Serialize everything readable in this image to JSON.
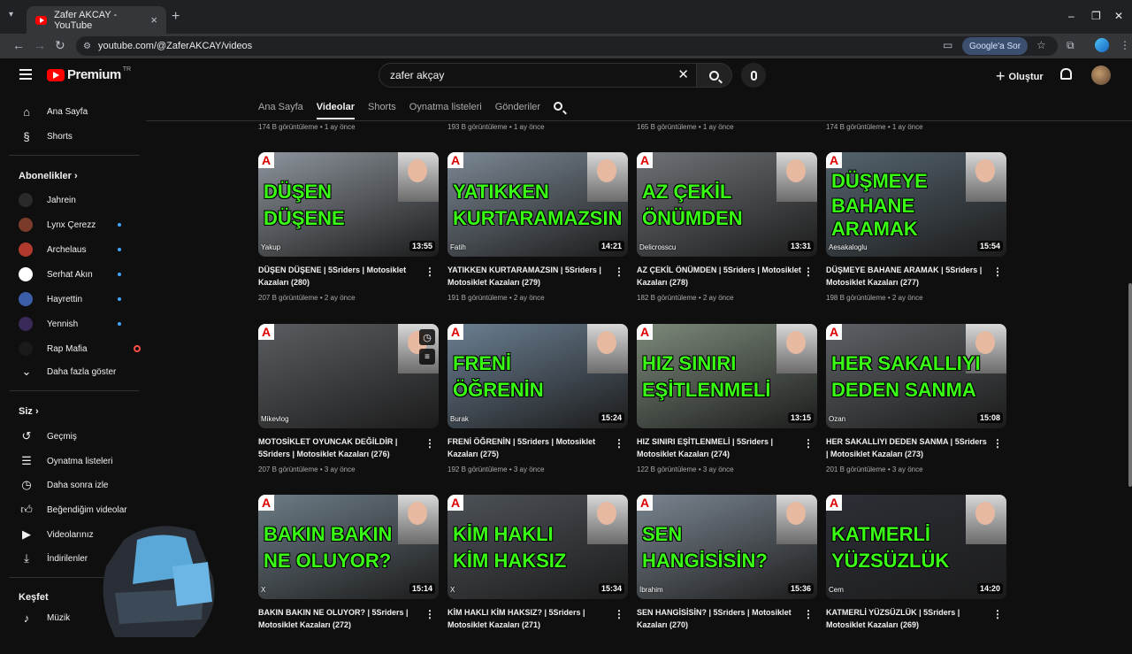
{
  "browser": {
    "tab_title": "Zafer AKCAY - YouTube",
    "url": "youtube.com/@ZaferAKCAY/videos",
    "google_sor": "Google'a Sor"
  },
  "topbar": {
    "logo_text": "Premium",
    "country": "TR",
    "search_value": "zafer akçay",
    "create_label": "Oluştur"
  },
  "sidebar": {
    "home": "Ana Sayfa",
    "shorts": "Shorts",
    "subs_header": "Abonelikler",
    "channels": [
      {
        "name": "Jahrein",
        "color": "#2a2a2a",
        "dot": false
      },
      {
        "name": "Lynx Çerezz",
        "color": "#7a3b2a",
        "dot": true
      },
      {
        "name": "Archelaus",
        "color": "#b03a2e",
        "dot": true
      },
      {
        "name": "Serhat Akın",
        "color": "#ffffff",
        "dot": true
      },
      {
        "name": "Hayrettin",
        "color": "#3b5ea8",
        "dot": true
      },
      {
        "name": "Yennish",
        "color": "#3a2a5a",
        "dot": true
      },
      {
        "name": "Rap Mafia",
        "color": "#1a1a1a",
        "dot": false
      }
    ],
    "show_more": "Daha fazla göster",
    "you_header": "Siz",
    "you_items": [
      "Geçmiş",
      "Oynatma listeleri",
      "Daha sonra izle",
      "Beğendiğim videolar",
      "Videolarınız",
      "İndirilenler"
    ],
    "explore_header": "Keşfet",
    "music": "Müzik"
  },
  "channel_tabs": [
    "Ana Sayfa",
    "Videolar",
    "Shorts",
    "Oynatma listeleri",
    "Gönderiler"
  ],
  "prev_row_meta": [
    "174 B görüntüleme • 1 ay önce",
    "193 B görüntüleme • 1 ay önce",
    "165 B görüntüleme • 1 ay önce",
    "174 B görüntüleme • 1 ay önce"
  ],
  "videos": [
    {
      "title": "DÜŞEN DÜŞENE | 5Sriders | Motosiklet Kazaları (280)",
      "meta": "207 B görüntüleme • 2 ay önce",
      "duration": "13:55",
      "overlay1": "DÜŞEN",
      "overlay2": "DÜŞENE",
      "caption": "Yakup",
      "bg": "#8d949c"
    },
    {
      "title": "YATIKKEN KURTARAMAZSIN | 5Sriders | Motosiklet Kazaları (279)",
      "meta": "191 B görüntüleme • 2 ay önce",
      "duration": "14:21",
      "overlay1": "YATIKKEN",
      "overlay2": "KURTARAMAZSIN",
      "caption": "Fatih",
      "bg": "#7b8894"
    },
    {
      "title": "AZ ÇEKİL ÖNÜMDEN | 5Sriders | Motosiklet Kazaları (278)",
      "meta": "182 B görüntüleme • 2 ay önce",
      "duration": "13:31",
      "overlay1": "AZ ÇEKİL",
      "overlay2": "ÖNÜMDEN",
      "caption": "Delicrosscu",
      "bg": "#6e7276"
    },
    {
      "title": "DÜŞMEYE BAHANE ARAMAK | 5Sriders | Motosiklet Kazaları (277)",
      "meta": "198 B görüntüleme • 2 ay önce",
      "duration": "15:54",
      "overlay1": "DÜŞMEYE",
      "overlay2": "BAHANE",
      "overlay3": "ARAMAK",
      "caption": "Aesakaloglu",
      "bg": "#55646e"
    },
    {
      "title": "MOTOSİKLET OYUNCAK DEĞİLDİR | 5Sriders | Motosiklet Kazaları (276)",
      "meta": "207 B görüntüleme • 3 ay önce",
      "duration": "",
      "overlay1": "",
      "overlay2": "",
      "caption": "Mikevlog",
      "bg": "#5a5d61"
    },
    {
      "title": "FRENİ ÖĞRENİN | 5Sriders | Motosiklet Kazaları (275)",
      "meta": "192 B görüntüleme • 3 ay önce",
      "duration": "15:24",
      "overlay1": "FRENİ",
      "overlay2": "ÖĞRENİN",
      "caption": "Burak",
      "bg": "#6b7f92"
    },
    {
      "title": "HIZ SINIRI EŞİTLENMELİ | 5Sriders | Motosiklet Kazaları (274)",
      "meta": "122 B görüntüleme • 3 ay önce",
      "duration": "13:15",
      "overlay1": "HIZ SINIRI",
      "overlay2": "EŞİTLENMELİ",
      "caption": "",
      "bg": "#7c8a7a"
    },
    {
      "title": "HER SAKALLIYI DEDEN SANMA | 5Sriders | Motosiklet Kazaları (273)",
      "meta": "201 B görüntüleme • 3 ay önce",
      "duration": "15:08",
      "overlay1": "HER SAKALLIYI",
      "overlay2": "DEDEN SANMA",
      "caption": "Ozan",
      "bg": "#5e6266"
    },
    {
      "title": "BAKIN BAKIN NE OLUYOR? | 5Sriders | Motosiklet Kazaları (272)",
      "meta": "",
      "duration": "15:14",
      "overlay1": "BAKIN BAKIN",
      "overlay2": "NE OLUYOR?",
      "caption": "X",
      "bg": "#6d7c86"
    },
    {
      "title": "KİM HAKLI KİM HAKSIZ? | 5Sriders | Motosiklet Kazaları (271)",
      "meta": "",
      "duration": "15:34",
      "overlay1": "KİM HAKLI",
      "overlay2": "KİM HAKSIZ",
      "caption": "X",
      "bg": "#4d5258"
    },
    {
      "title": "SEN HANGİSİSİN? | 5Sriders | Motosiklet Kazaları (270)",
      "meta": "",
      "duration": "15:36",
      "overlay1": "SEN",
      "overlay2": "HANGİSİSİN?",
      "caption": "İbrahim",
      "bg": "#7a8590"
    },
    {
      "title": "KATMERLİ YÜZSÜZLÜK | 5Sriders | Motosiklet Kazaları (269)",
      "meta": "",
      "duration": "14:20",
      "overlay1": "KATMERLİ",
      "overlay2": "YÜZSÜZLÜK",
      "caption": "Cem",
      "bg": "#2c2f36"
    }
  ]
}
